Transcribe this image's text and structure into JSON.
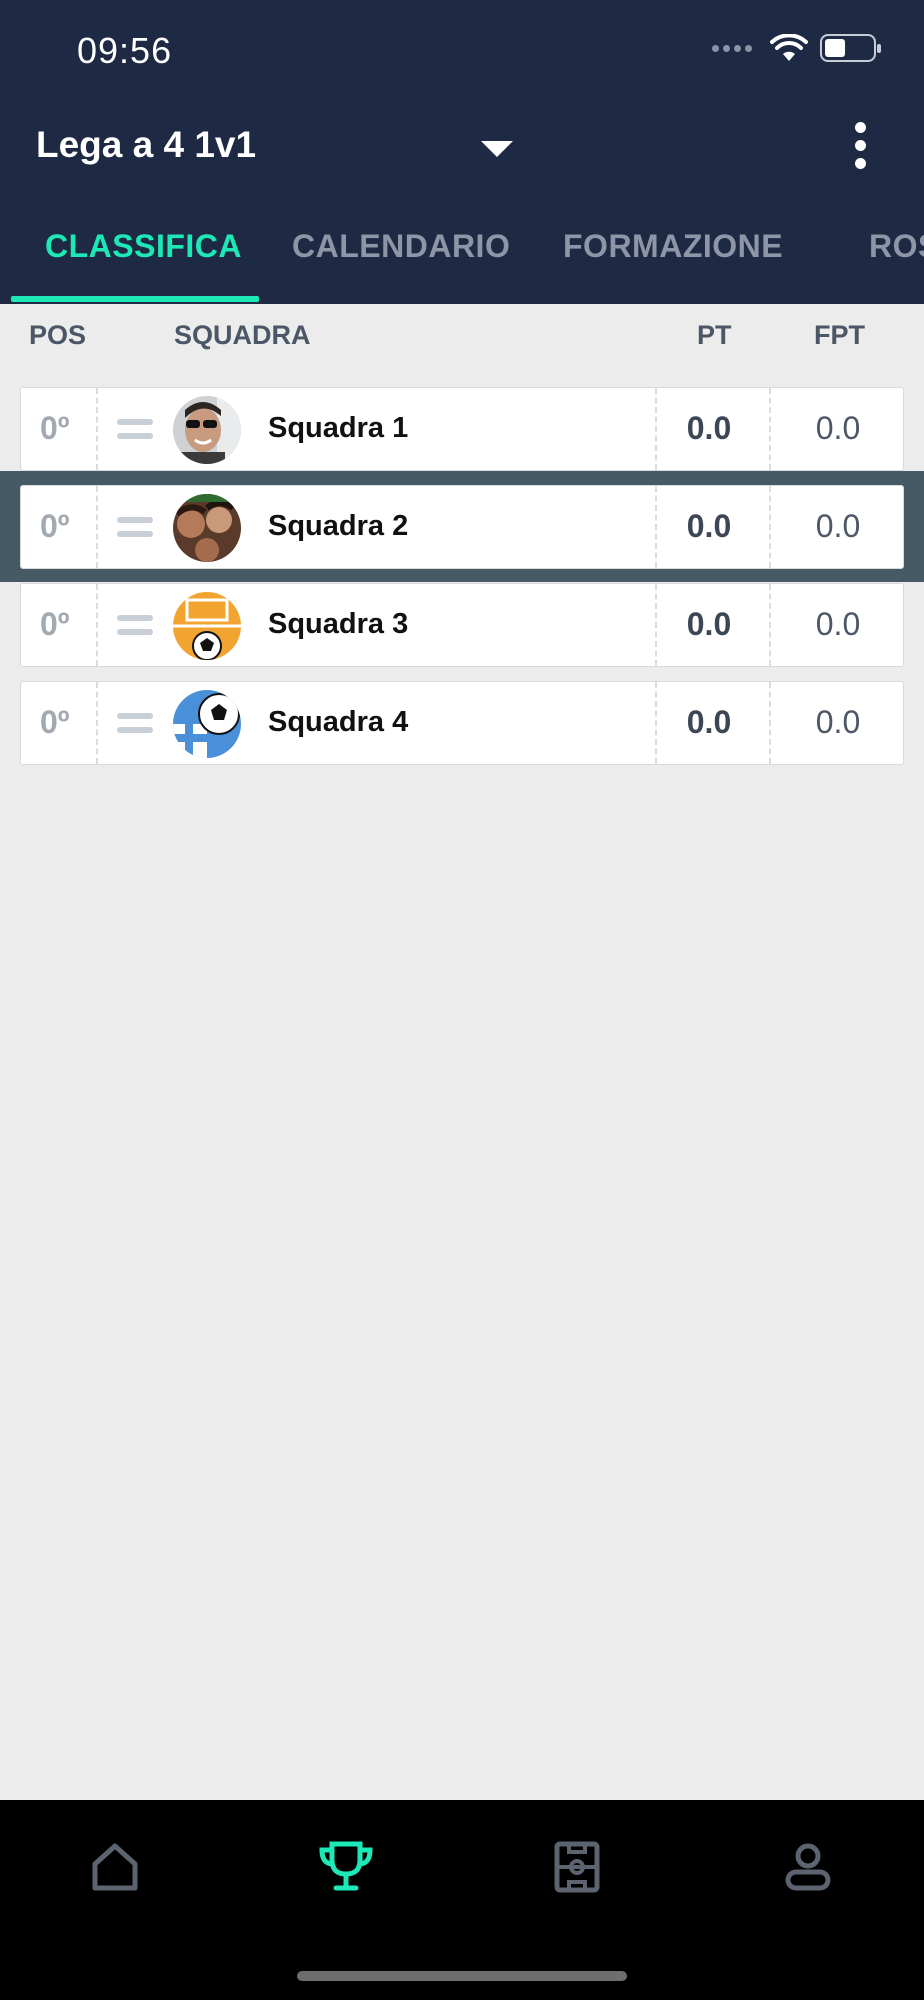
{
  "status_bar": {
    "time": "09:56"
  },
  "header": {
    "league_title": "Lega a 4 1v1",
    "dropdown_icon": "caret-down-icon",
    "more_icon": "more-vertical-icon"
  },
  "tabs": [
    {
      "label": "CLASSIFICA",
      "active": true
    },
    {
      "label": "CALENDARIO",
      "active": false
    },
    {
      "label": "FORMAZIONE",
      "active": false
    },
    {
      "label": "ROS",
      "active": false
    }
  ],
  "table": {
    "headers": {
      "pos": "POS",
      "team": "SQUADRA",
      "pt": "PT",
      "fpt": "FPT"
    },
    "rows": [
      {
        "pos": "0º",
        "name": "Squadra 1",
        "pt": "0.0",
        "fpt": "0.0",
        "avatar": "person-sunglasses-avatar"
      },
      {
        "pos": "0º",
        "name": "Squadra 2",
        "pt": "0.0",
        "fpt": "0.0",
        "avatar": "group-selfie-avatar",
        "highlighted": true
      },
      {
        "pos": "0º",
        "name": "Squadra 3",
        "pt": "0.0",
        "fpt": "0.0",
        "avatar": "soccer-goal-avatar"
      },
      {
        "pos": "0º",
        "name": "Squadra 4",
        "pt": "0.0",
        "fpt": "0.0",
        "avatar": "soccer-ball-blue-avatar"
      }
    ]
  },
  "bottom_nav": [
    {
      "icon": "home-icon",
      "active": false
    },
    {
      "icon": "trophy-icon",
      "active": true
    },
    {
      "icon": "field-icon",
      "active": false
    },
    {
      "icon": "profile-icon",
      "active": false
    }
  ],
  "colors": {
    "header_bg": "#1e2a44",
    "accent": "#1de9b6",
    "highlight_band": "#455a64",
    "page_bg": "#ececec"
  }
}
